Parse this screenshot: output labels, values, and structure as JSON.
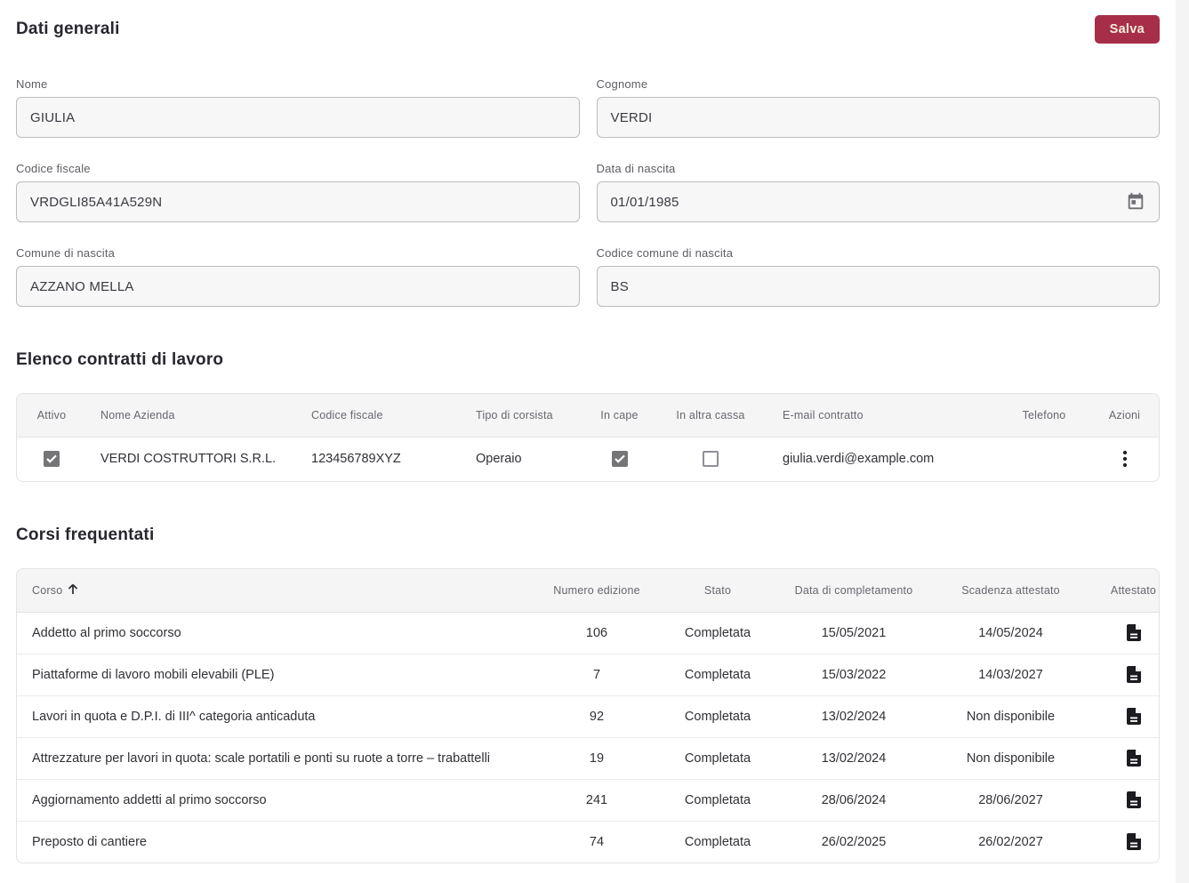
{
  "colors": {
    "accent": "#a72e49",
    "save_text": "#f8eedb",
    "checkbox_checked": "#757578",
    "table_header_bg": "#f5f5f6"
  },
  "header": {
    "title": "Dati generali",
    "save_label": "Salva"
  },
  "form": {
    "nome": {
      "label": "Nome",
      "value": "GIULIA"
    },
    "cognome": {
      "label": "Cognome",
      "value": "VERDI"
    },
    "codice_fiscale": {
      "label": "Codice fiscale",
      "value": "VRDGLI85A41A529N"
    },
    "data_nascita": {
      "label": "Data di nascita",
      "value": "01/01/1985",
      "icon": "calendar-icon"
    },
    "comune_nascita": {
      "label": "Comune di nascita",
      "value": "AZZANO MELLA"
    },
    "codice_comune_nascita": {
      "label": "Codice comune di nascita",
      "value": "BS"
    }
  },
  "contracts": {
    "title": "Elenco contratti di lavoro",
    "columns": [
      "Attivo",
      "Nome Azienda",
      "Codice fiscale",
      "Tipo di corsista",
      "In cape",
      "In altra cassa",
      "E-mail contratto",
      "Telefono",
      "Azioni"
    ],
    "row": {
      "attivo": true,
      "nome_azienda": "VERDI COSTRUTTORI S.R.L.",
      "codice_fiscale": "123456789XYZ",
      "tipo_di_corsista": "Operaio",
      "in_cape": true,
      "in_altra_cassa": false,
      "email": "giulia.verdi@example.com",
      "telefono": "",
      "azioni_icon": "kebab-menu-icon"
    }
  },
  "courses": {
    "title": "Corsi frequentati",
    "columns": [
      "Corso",
      "Numero edizione",
      "Stato",
      "Data di completamento",
      "Scadenza attestato",
      "Attestato"
    ],
    "sort": {
      "column": "Corso",
      "direction": "asc",
      "icon": "arrow-up-icon"
    },
    "attestato_icon": "document-icon",
    "rows": [
      {
        "corso": "Addetto al primo soccorso",
        "numero_edizione": "106",
        "stato": "Completata",
        "data_completamento": "15/05/2021",
        "scadenza_attestato": "14/05/2024"
      },
      {
        "corso": "Piattaforme di lavoro mobili elevabili (PLE)",
        "numero_edizione": "7",
        "stato": "Completata",
        "data_completamento": "15/03/2022",
        "scadenza_attestato": "14/03/2027"
      },
      {
        "corso": "Lavori in quota e D.P.I. di III^ categoria anticaduta",
        "numero_edizione": "92",
        "stato": "Completata",
        "data_completamento": "13/02/2024",
        "scadenza_attestato": "Non disponibile"
      },
      {
        "corso": "Attrezzature per lavori in quota: scale portatili e ponti su ruote a torre – trabattelli",
        "numero_edizione": "19",
        "stato": "Completata",
        "data_completamento": "13/02/2024",
        "scadenza_attestato": "Non disponibile"
      },
      {
        "corso": "Aggiornamento addetti al primo soccorso",
        "numero_edizione": "241",
        "stato": "Completata",
        "data_completamento": "28/06/2024",
        "scadenza_attestato": "28/06/2027"
      },
      {
        "corso": "Preposto di cantiere",
        "numero_edizione": "74",
        "stato": "Completata",
        "data_completamento": "26/02/2025",
        "scadenza_attestato": "26/02/2027"
      }
    ]
  }
}
